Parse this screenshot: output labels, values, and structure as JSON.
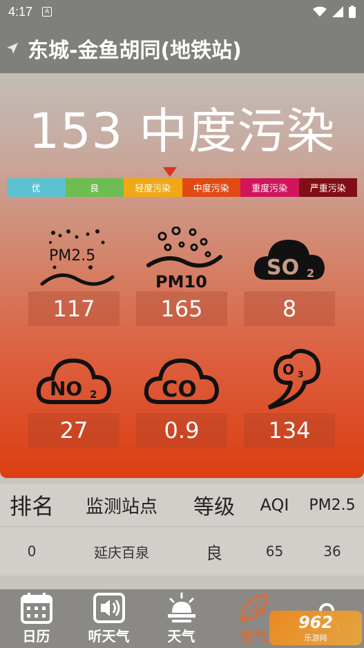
{
  "status_bar": {
    "time": "4:17",
    "notif_letter": "A"
  },
  "header": {
    "title": "东城-金鱼胡同(地铁站)"
  },
  "aqi": {
    "value": "153",
    "level": "中度污染",
    "display": "153 中度污染"
  },
  "scale": [
    {
      "label": "优",
      "color": "#5cc1d0"
    },
    {
      "label": "良",
      "color": "#6ebd52"
    },
    {
      "label": "轻度污染",
      "color": "#f0a814"
    },
    {
      "label": "中度污染",
      "color": "#e24a14"
    },
    {
      "label": "重度污染",
      "color": "#d0155a"
    },
    {
      "label": "严重污染",
      "color": "#800e16"
    }
  ],
  "pollutants": [
    {
      "name": "PM2.5",
      "value": "117"
    },
    {
      "name": "PM10",
      "value": "165"
    },
    {
      "name": "SO2",
      "value": "8"
    },
    {
      "name": "NO2",
      "value": "27"
    },
    {
      "name": "CO",
      "value": "0.9"
    },
    {
      "name": "O3",
      "value": "134"
    }
  ],
  "ranking": {
    "headers": [
      "排名",
      "监测站点",
      "等级",
      "AQI",
      "PM2.5"
    ],
    "rows": [
      [
        "0",
        "延庆百泉",
        "良",
        "65",
        "36"
      ]
    ]
  },
  "nav": [
    {
      "label": "日历",
      "icon": "calendar-icon"
    },
    {
      "label": "听天气",
      "icon": "speaker-icon"
    },
    {
      "label": "天气",
      "icon": "sun-cloud-icon"
    },
    {
      "label": "空气",
      "icon": "leaf-pm-icon"
    },
    {
      "label": "",
      "icon": "person-icon"
    }
  ],
  "watermark": {
    "line1": "962",
    "line2": "乐游网"
  },
  "colors": {
    "accent": "#e2692f",
    "bar": "#7f7f7c"
  }
}
